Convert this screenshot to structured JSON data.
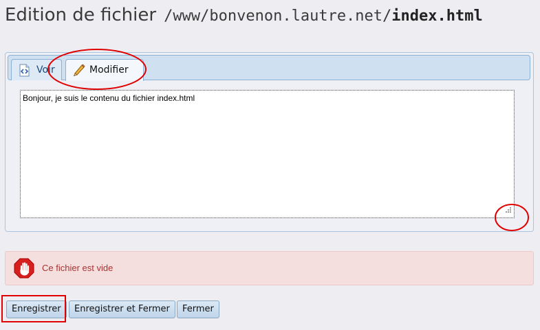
{
  "header": {
    "label": "Edition de fichier",
    "path": "/www/bonvenon.lautre.net/",
    "filename": "index.html"
  },
  "tabs": [
    {
      "label": "Voir",
      "icon": "code-file-icon"
    },
    {
      "label": "Modifier",
      "icon": "pencil-icon",
      "active": true
    }
  ],
  "editor": {
    "content": "Bonjour, je suis le contenu du fichier index.html"
  },
  "alert": {
    "message": "Ce fichier est vide",
    "icon": "stop-hand-icon"
  },
  "buttons": {
    "save": "Enregistrer",
    "save_close": "Enregistrer et Fermer",
    "close": "Fermer"
  },
  "colors": {
    "tab_bar": "#cfe1f1",
    "alert_bg": "#f4dede",
    "alert_text": "#aa3333",
    "annotation": "#e00000"
  }
}
